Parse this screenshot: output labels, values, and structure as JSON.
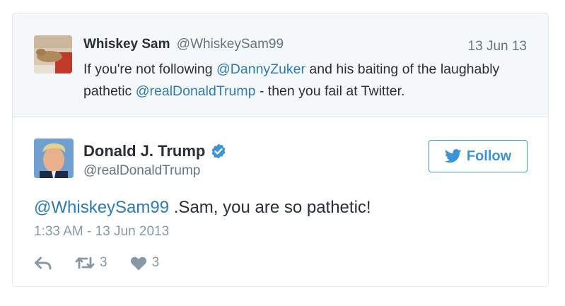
{
  "reply_context": {
    "name": "Whiskey Sam",
    "handle": "@WhiskeySam99",
    "date": "13 Jun 13",
    "text_part1": "If you're not following ",
    "mention1": "@DannyZuker",
    "text_part2": " and his baiting of the laughably pathetic ",
    "mention2": "@realDonaldTrump",
    "text_part3": " - then you fail at Twitter."
  },
  "tweet": {
    "name": "Donald J. Trump",
    "handle": "@realDonaldTrump",
    "verified": true,
    "mention": "@WhiskeySam99",
    "text": " .Sam, you are so pathetic!",
    "timestamp": "1:33 AM - 13 Jun 2013",
    "retweets": "3",
    "likes": "3"
  },
  "follow_button": {
    "label": "Follow",
    "icon": "twitter-bird-icon"
  },
  "icons": {
    "verified": "verified-badge-icon",
    "reply": "reply-icon",
    "retweet": "retweet-icon",
    "like": "heart-icon"
  },
  "colors": {
    "link": "#2b7bb9",
    "follow": "#3b94d9",
    "muted": "#8899a6",
    "context_bg": "#f5f8fa"
  }
}
